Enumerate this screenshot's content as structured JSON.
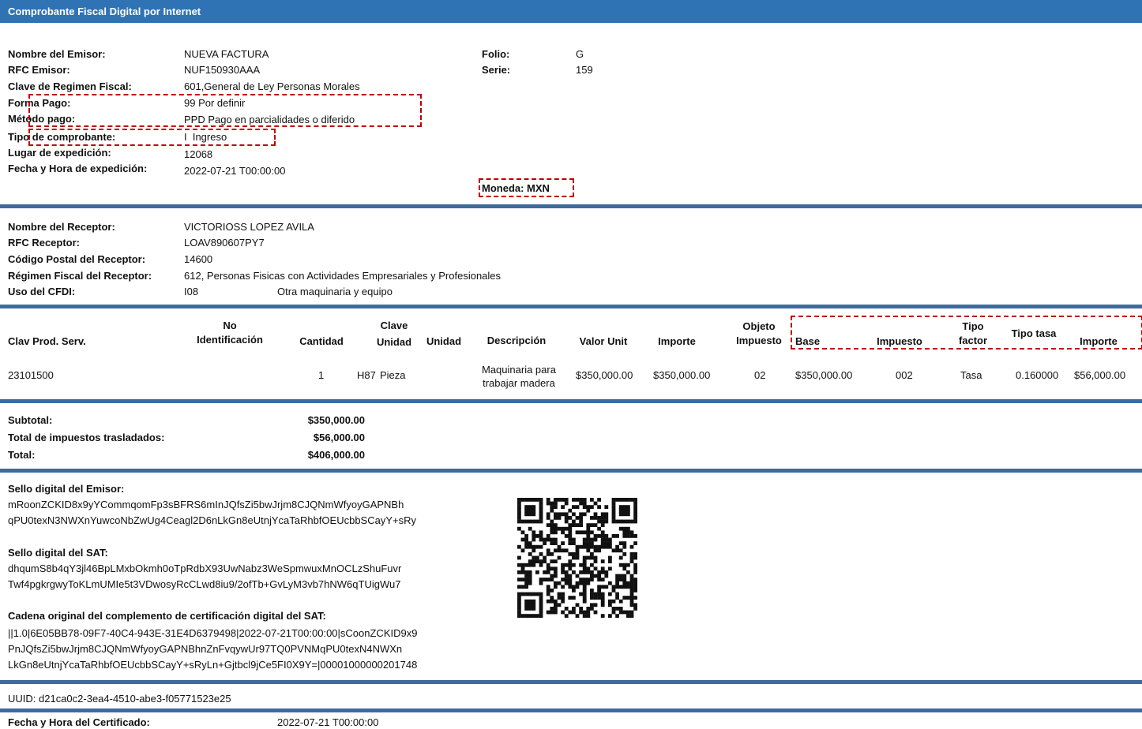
{
  "title": "Comprobante Fiscal Digital por Internet",
  "emisor": {
    "nombre_label": "Nombre del Emisor:",
    "nombre": "NUEVA FACTURA",
    "rfc_label": "RFC Emisor:",
    "rfc": "NUF150930AAA",
    "regimen_label": "Clave de Regimen Fiscal:",
    "regimen": "601,General de Ley Personas Morales",
    "forma_pago_label": "Forma Pago:",
    "forma_pago": "99 Por definir",
    "metodo_pago_label": "Método pago:",
    "metodo_pago": "PPD Pago en parcialidades o diferido",
    "tipo_label": "Tipo de comprobante:",
    "tipo": "I  Ingreso",
    "lugar_label": "Lugar de expedición:",
    "lugar": "12068",
    "fecha_label": "Fecha y Hora de expedición:",
    "fecha": "2022-07-21 T00:00:00",
    "folio_label": "Folio:",
    "folio": "G",
    "serie_label": "Serie:",
    "serie": "159",
    "moneda": "Moneda: MXN"
  },
  "receptor": {
    "nombre_label": "Nombre del Receptor:",
    "nombre": "VICTORIOSS LOPEZ AVILA",
    "rfc_label": "RFC Receptor:",
    "rfc": "LOAV890607PY7",
    "cp_label": "Código Postal del Receptor:",
    "cp": "14600",
    "regimen_label": "Régimen Fiscal del Receptor:",
    "regimen": "612, Personas Fisicas con Actividades Empresariales y Profesionales",
    "uso_label": "Uso del CFDI:",
    "uso_code": "I08",
    "uso_desc": "Otra maquinaria y equipo"
  },
  "table": {
    "headers": {
      "clave_prod": "Clav Prod. Serv.",
      "no_id_1": "No",
      "no_id_2": "Identificación",
      "cantidad": "Cantidad",
      "clave_unidad_1": "Clave",
      "clave_unidad_2": "Unidad",
      "unidad": "Unidad",
      "descripcion": "Descripción",
      "valor_unit": "Valor Unit",
      "importe": "Importe",
      "objeto_1": "Objeto",
      "objeto_2": "Impuesto",
      "base": "Base",
      "impuesto": "Impuesto",
      "tipo_factor_1": "Tipo",
      "tipo_factor_2": "factor",
      "tipo_tasa": "Tipo tasa",
      "importe_tax": "Importe"
    },
    "row": {
      "clave_prod": "23101500",
      "cantidad": "1",
      "clave_unidad": "H87",
      "unidad": "Pieza",
      "descripcion_1": "Maquinaria para",
      "descripcion_2": "trabajar madera",
      "valor_unit": "$350,000.00",
      "importe": "$350,000.00",
      "objeto": "02",
      "base": "$350,000.00",
      "impuesto": "002",
      "tipo_factor": "Tasa",
      "tipo_tasa": "0.160000",
      "importe_tax": "$56,000.00"
    }
  },
  "totals": {
    "subtotal_label": "Subtotal:",
    "subtotal": "$350,000.00",
    "impuestos_label": "Total de impuestos trasladados:",
    "impuestos": "$56,000.00",
    "total_label": "Total:",
    "total": "$406,000.00"
  },
  "sellos": {
    "emisor_label": "Sello digital del Emisor:",
    "emisor_1": "mRoonZCKID8x9yYCommqomFp3sBFRS6mInJQfsZi5bwJrjm8CJQNmWfyoyGAPNBh",
    "emisor_2": "qPU0texN3NWXnYuwcoNbZwUg4Ceagl2D6nLkGn8eUtnjYcaTaRhbfOEUcbbSCayY+sRy",
    "sat_label": "Sello digital del SAT:",
    "sat_1": "dhqumS8b4qY3jl46BpLMxbOkmh0oTpRdbX93UwNabz3WeSpmwuxMnOCLzShuFuvr",
    "sat_2": "Twf4pgkrgwyToKLmUMIe5t3VDwosyRcCLwd8iu9/2ofTb+GvLyM3vb7hNW6qTUigWu7",
    "cadena_label": "Cadena original del complemento de certificación digital del SAT:",
    "cadena_1": "||1.0|6E05BB78-09F7-40C4-943E-31E4D6379498|2022-07-21T00:00:00|sCoonZCKID9x9",
    "cadena_2": "PnJQfsZi5bwJrjm8CJQNmWfyoyGAPNBhnZnFvqywUr97TQ0PVNMqPU0texN4NWXn",
    "cadena_3": "LkGn8eUtnjYcaTaRhbfOEUcbbSCayY+sRyLn+Gjtbcl9jCe5FI0X9Y=|00001000000201748"
  },
  "uuid": "UUID: d21ca0c2-3ea4-4510-abe3-f05771523e25",
  "certificado_label": "Fecha y Hora del Certificado:",
  "certificado": "2022-07-21 T00:00:00"
}
